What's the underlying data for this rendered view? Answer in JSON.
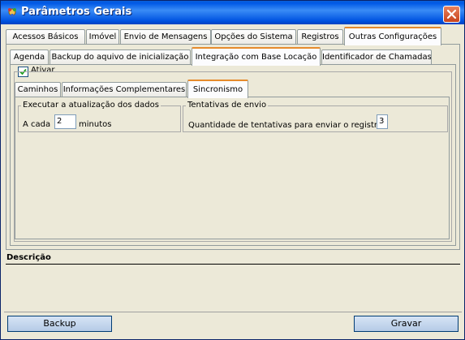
{
  "window": {
    "title": "Parâmetros Gerais",
    "title_icon": "app-icon",
    "close_icon": "close-icon"
  },
  "main_tabs": [
    {
      "label": "Acessos Básicos",
      "active": false
    },
    {
      "label": "Imóvel",
      "active": false
    },
    {
      "label": "Envio de Mensagens",
      "active": false
    },
    {
      "label": "Opções do Sistema",
      "active": false
    },
    {
      "label": "Registros",
      "active": false
    },
    {
      "label": "Outras Configurações",
      "active": true
    }
  ],
  "sub_tabs": [
    {
      "label": "Agenda",
      "active": false
    },
    {
      "label": "Backup do aquivo de inicialização",
      "active": false
    },
    {
      "label": "Integração com Base Locação",
      "active": true
    },
    {
      "label": "Identificador de Chamadas",
      "active": false
    }
  ],
  "integration": {
    "ativar_label": "Ativar",
    "ativar_checked": true
  },
  "inner_tabs": [
    {
      "label": "Caminhos",
      "active": false
    },
    {
      "label": "Informações Complementares",
      "active": false
    },
    {
      "label": "Sincronismo",
      "active": true
    }
  ],
  "sincronismo": {
    "update_group": {
      "legend": "Executar a atualização dos dados",
      "prefix": "A cada",
      "value": "2",
      "suffix": "minutos"
    },
    "attempts_group": {
      "legend": "Tentativas de envio",
      "label": "Quantidade de tentativas para enviar o registro",
      "value": "3"
    }
  },
  "description": {
    "label": "Descrição"
  },
  "buttons": {
    "backup": "Backup",
    "save": "Gravar"
  },
  "colors": {
    "title_bar": "#0058e6",
    "active_tab_accent": "#e68b2c",
    "window_bg": "#ece9d8"
  }
}
